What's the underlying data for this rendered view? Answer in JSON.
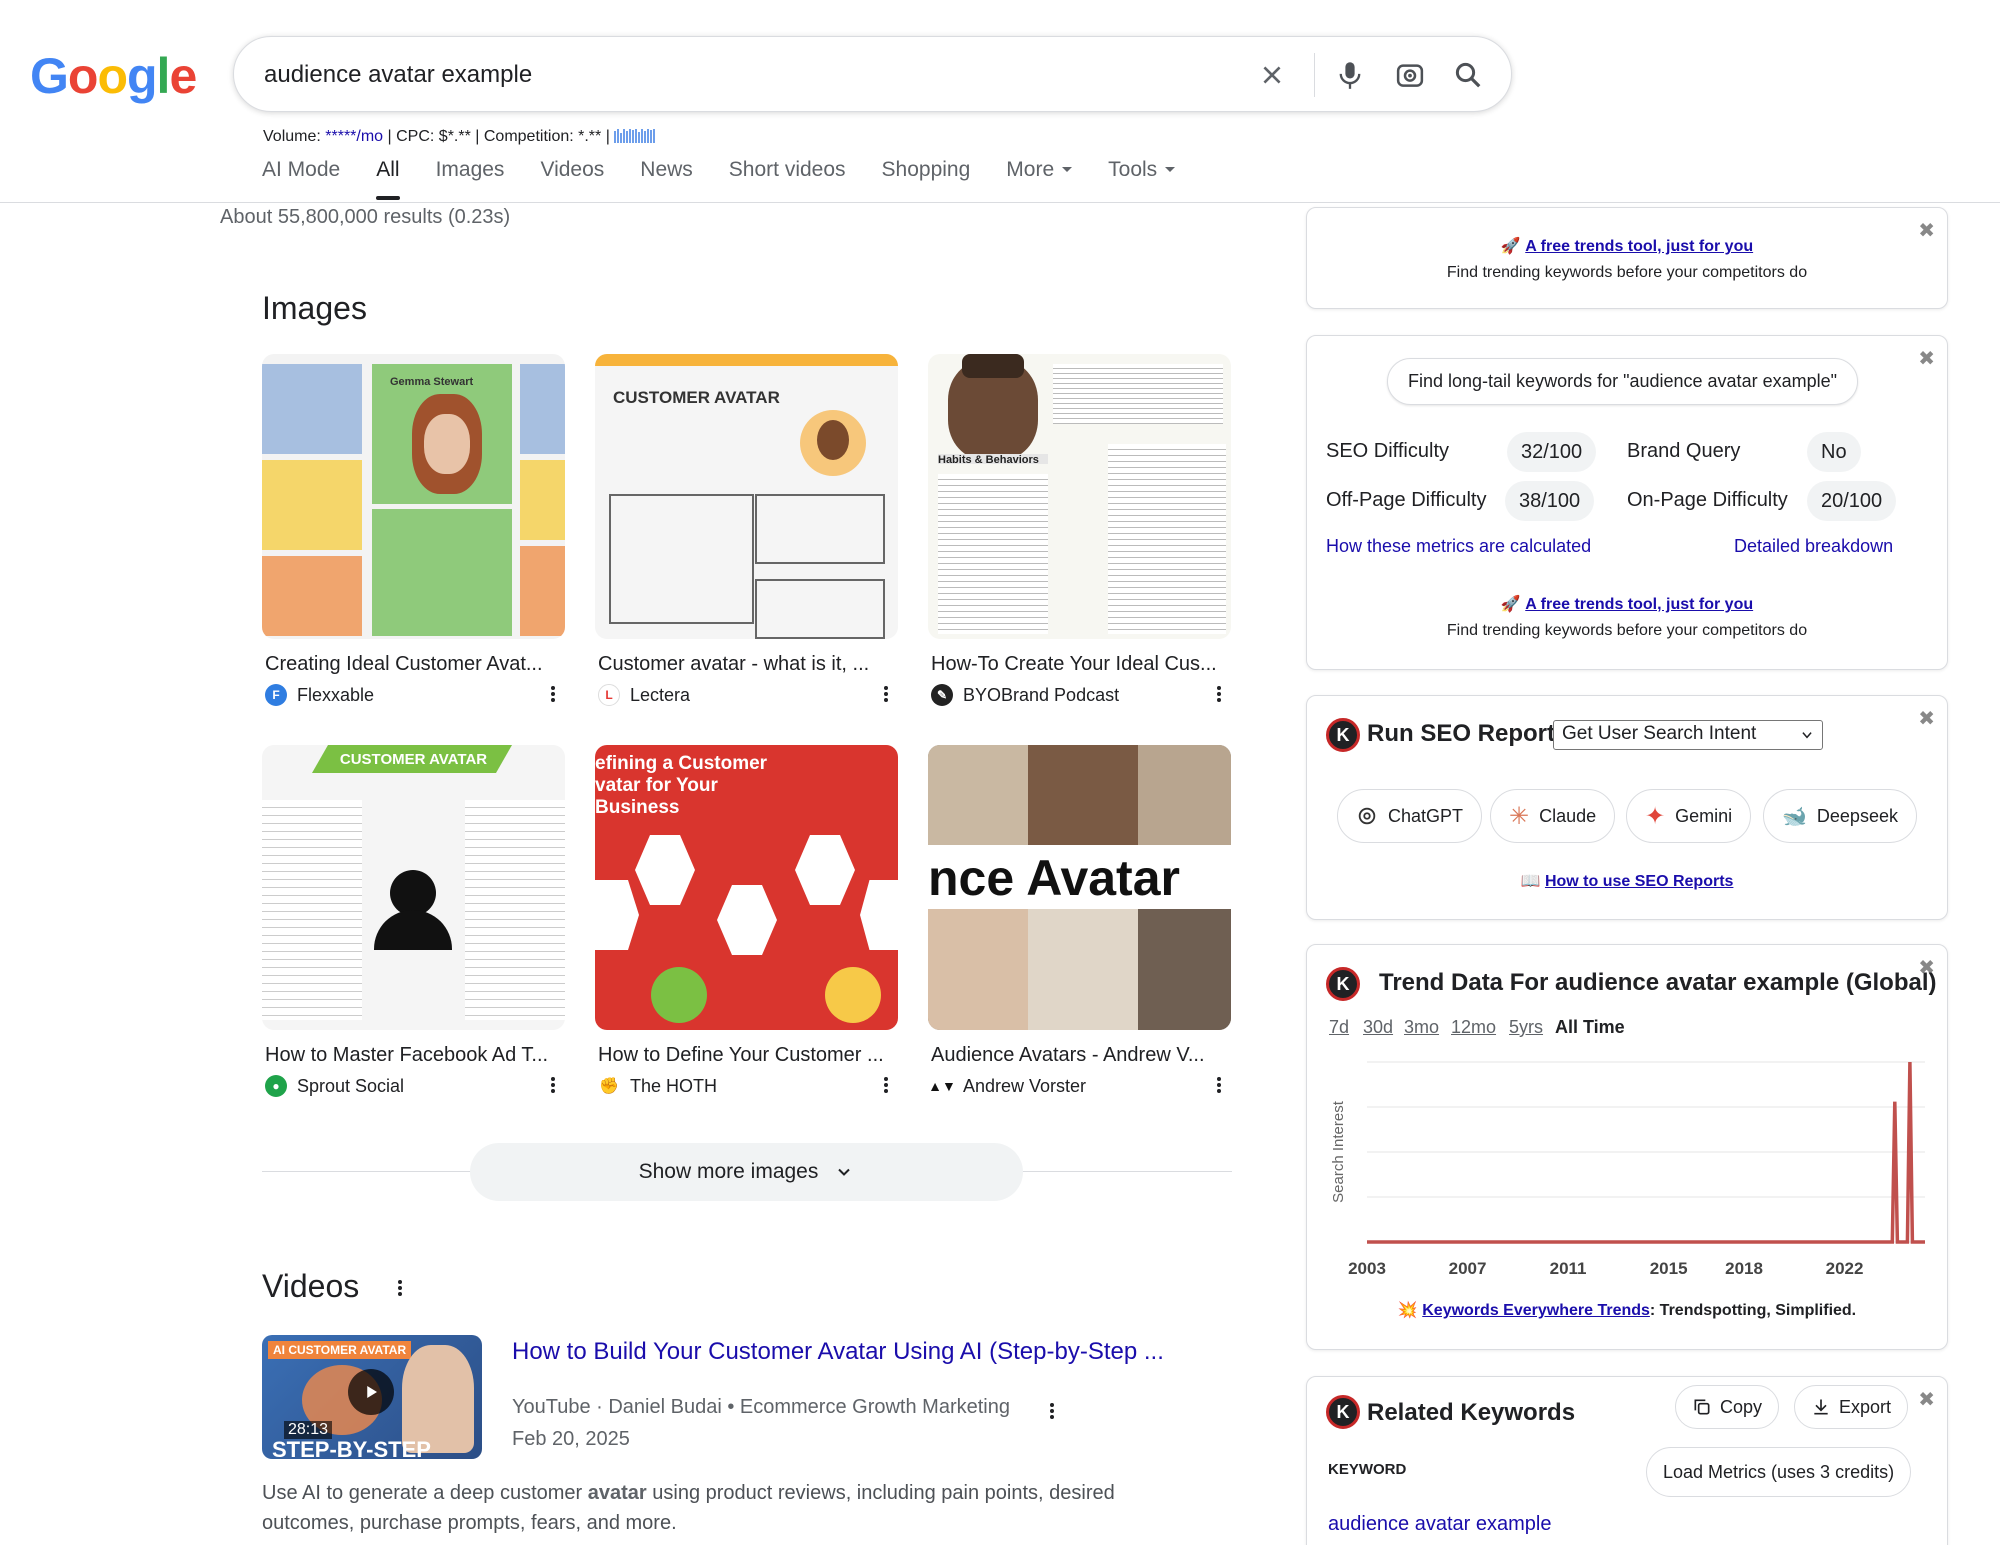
{
  "header": {
    "logo": "Google",
    "query": "audience avatar example",
    "metrics": {
      "volume_label": "Volume: ",
      "volume_value": "*****/mo",
      "cpc": " | CPC: $*.** | Competition: *.** | "
    }
  },
  "tabs": [
    "AI Mode",
    "All",
    "Images",
    "Videos",
    "News",
    "Short videos",
    "Shopping",
    "More",
    "Tools"
  ],
  "active_tab": "All",
  "result_stats": "About 55,800,000 results (0.23s)",
  "images": {
    "title": "Images",
    "items": [
      {
        "title": "Creating Ideal Customer Avat...",
        "source": "Flexxable",
        "thumb_text": "Gemma Stewart"
      },
      {
        "title": "Customer avatar - what is it, ...",
        "source": "Lectera",
        "thumb_text": "CUSTOMER AVATAR"
      },
      {
        "title": "How-To Create Your Ideal Cus...",
        "source": "BYOBrand Podcast",
        "thumb_text": "Habits & Behaviors"
      },
      {
        "title": "How to Master Facebook Ad T...",
        "source": "Sprout Social",
        "thumb_text": "CUSTOMER AVATAR"
      },
      {
        "title": "How to Define Your Customer ...",
        "source": "The HOTH",
        "thumb_text": "efining a Customer vatar for Your Business"
      },
      {
        "title": "Audience Avatars - Andrew V...",
        "source": "Andrew Vorster",
        "thumb_text": "nce Avatar"
      }
    ],
    "show_more": "Show more images"
  },
  "videos": {
    "title": "Videos",
    "item": {
      "title": "How to Build Your Customer Avatar Using AI (Step-by-Step ...",
      "meta": "YouTube · Daniel Budai • Ecommerce Growth Marketing",
      "date": "Feb 20, 2025",
      "duration": "28:13",
      "thumb_label": "AI CUSTOMER AVATAR",
      "thumb_caption": "STEP-BY-STEP",
      "desc_before": "Use AI to generate a deep customer ",
      "desc_bold": "avatar",
      "desc_after": " using product reviews, including pain points, desired outcomes, purchase prompts, fears, and more."
    }
  },
  "panels": {
    "promo": {
      "link": "A free trends tool, just for you",
      "sub": "Find trending keywords before your competitors do"
    },
    "metrics": {
      "longtail_btn": "Find long-tail keywords for \"audience avatar example\"",
      "seo_difficulty_label": "SEO Difficulty",
      "seo_difficulty": "32/100",
      "brand_query_label": "Brand Query",
      "brand_query": "No",
      "offpage_label": "Off-Page Difficulty",
      "offpage": "38/100",
      "onpage_label": "On-Page Difficulty",
      "onpage": "20/100",
      "how_link": "How these metrics are calculated",
      "breakdown_link": "Detailed breakdown"
    },
    "seo_report": {
      "title": "Run SEO Report",
      "select_value": "Get User Search Intent",
      "buttons": [
        "ChatGPT",
        "Claude",
        "Gemini",
        "Deepseek"
      ],
      "howto": "How to use SEO Reports"
    },
    "trend": {
      "title": "Trend Data For audience avatar example (Global)",
      "ranges": [
        "7d",
        "30d",
        "3mo",
        "12mo",
        "5yrs",
        "All Time"
      ],
      "active_range": "All Time",
      "footer_link": "Keywords Everywhere Trends",
      "footer_rest": ": Trendspotting, Simplified."
    },
    "related": {
      "title": "Related Keywords",
      "copy": "Copy",
      "export": "Export",
      "col_header": "KEYWORD",
      "load_metrics": "Load Metrics (uses 3 credits)",
      "first_keyword": "audience avatar example"
    }
  },
  "chart_data": {
    "type": "line",
    "title": "",
    "xlabel": "",
    "ylabel": "Search Interest",
    "x_ticks": [
      "2003",
      "2007",
      "2011",
      "2015",
      "2018",
      "2022"
    ],
    "series": [
      {
        "points": [
          [
            2003,
            0
          ],
          [
            2022,
            0
          ],
          [
            2023.9,
            0
          ],
          [
            2024.0,
            78
          ],
          [
            2024.1,
            0
          ],
          [
            2024.5,
            0
          ],
          [
            2024.6,
            100
          ],
          [
            2024.7,
            0
          ],
          [
            2025.2,
            0
          ]
        ]
      }
    ],
    "xlim": [
      2003,
      2025.2
    ],
    "ylim": [
      0,
      100
    ],
    "line_color": "#c0504d",
    "grid": true
  }
}
